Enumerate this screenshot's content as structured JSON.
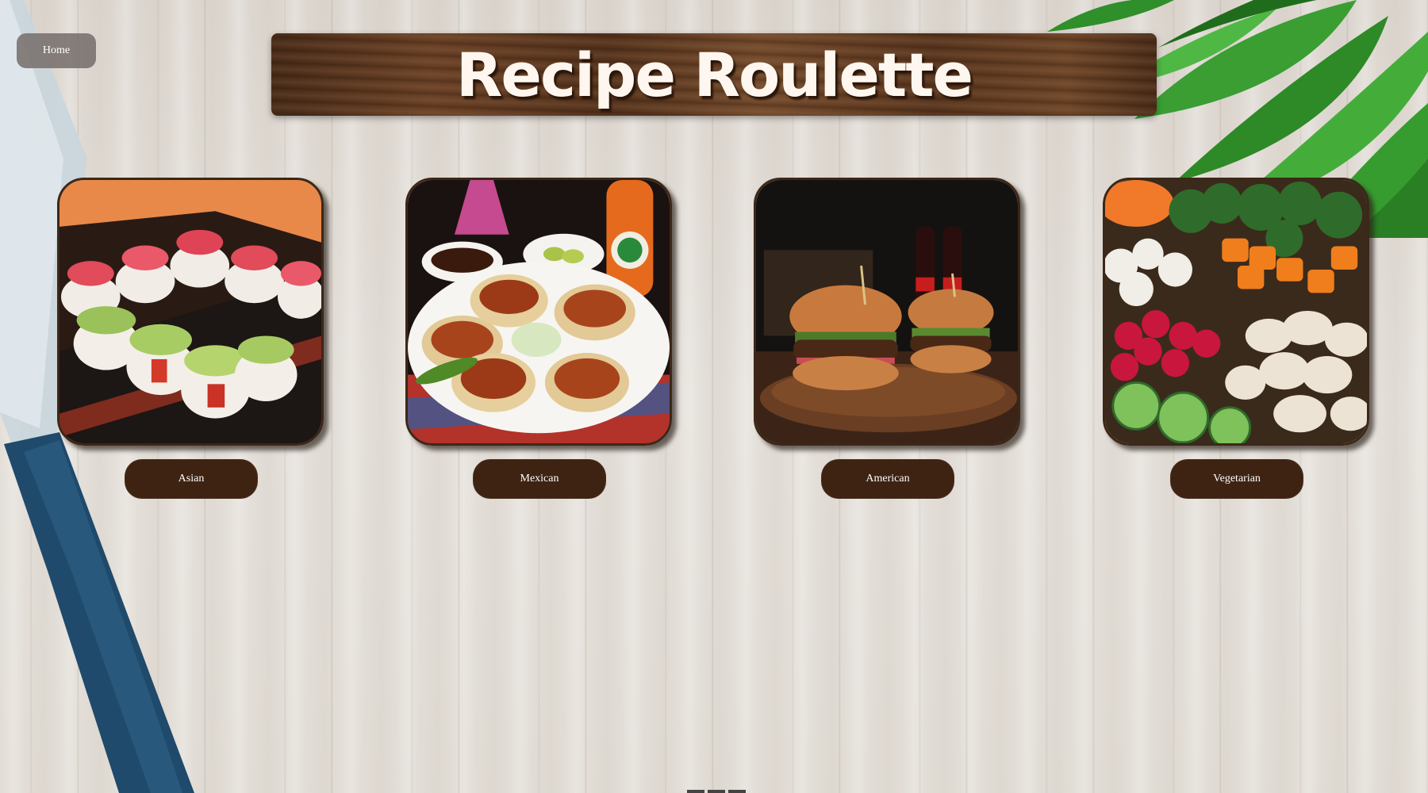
{
  "nav": {
    "home_label": "Home"
  },
  "header": {
    "title": "Recipe Roulette"
  },
  "categories": [
    {
      "label": "Asian",
      "image": "sushi-rolls-photo"
    },
    {
      "label": "Mexican",
      "image": "tacos-photo"
    },
    {
      "label": "American",
      "image": "burgers-photo"
    },
    {
      "label": "Vegetarian",
      "image": "vegetables-photo"
    }
  ],
  "colors": {
    "banner_wood": "#5a361e",
    "button_brown": "#3e2313",
    "home_button": "#78706c",
    "title_text": "#fff7ef"
  }
}
